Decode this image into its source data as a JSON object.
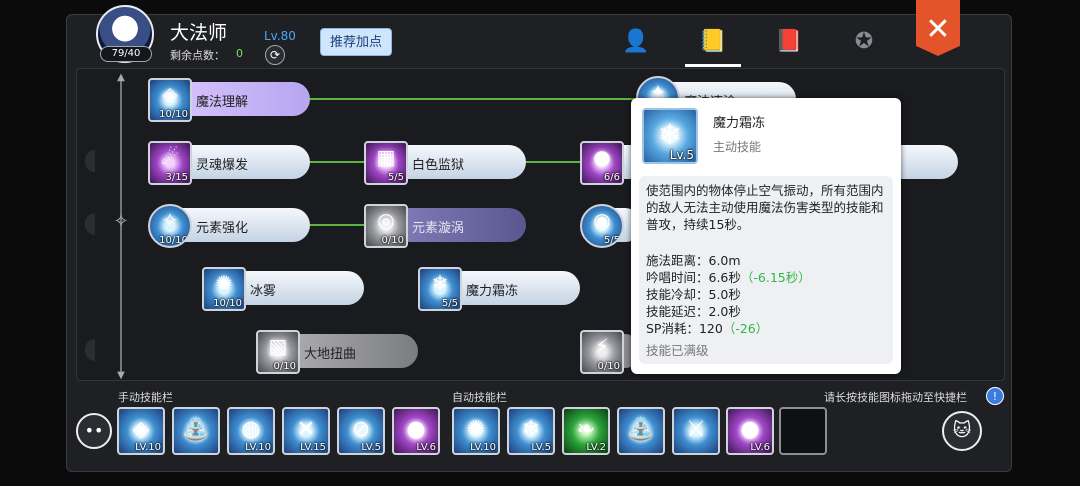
{
  "header": {
    "avatar_count": "79/40",
    "name": "大法师",
    "points_label": "剩余点数：",
    "points_value": "0",
    "level": "Lv.80",
    "recommend_label": "推荐加点",
    "tabs": [
      "character-icon",
      "skill-book-icon",
      "book-icon",
      "emblem-icon"
    ],
    "active_tab": "skill-book-icon",
    "close_icon": "close-x-icon"
  },
  "skills": [
    {
      "name": "魔法理解",
      "level": "10/10",
      "icon": "diamond-rune-icon",
      "color": "blue"
    },
    {
      "name": "魔法速涂",
      "level": "",
      "icon": "star-rune-icon",
      "color": "blue"
    },
    {
      "name": "灵魂爆发",
      "level": "3/15",
      "icon": "soul-burst-icon",
      "color": "purple"
    },
    {
      "name": "白色监狱",
      "level": "5/5",
      "icon": "prism-cage-icon",
      "color": "purple"
    },
    {
      "name": "",
      "level": "6/6",
      "icon": "purple-orb-icon",
      "color": "purple"
    },
    {
      "name": "元素强化",
      "level": "10/10",
      "icon": "element-star-icon",
      "color": "blue"
    },
    {
      "name": "元素漩涡",
      "level": "0/10",
      "icon": "vortex-icon",
      "color": "gray"
    },
    {
      "name": "",
      "level": "5/5",
      "icon": "eye-rune-icon",
      "color": "blue"
    },
    {
      "name": "冰雾",
      "level": "10/10",
      "icon": "ice-mist-icon",
      "color": "blue"
    },
    {
      "name": "魔力霜冻",
      "level": "5/5",
      "icon": "snowflake-icon",
      "color": "blue"
    },
    {
      "name": "大地扭曲",
      "level": "0/10",
      "icon": "earth-crack-icon",
      "color": "gray"
    },
    {
      "name": "",
      "level": "0/10",
      "icon": "lightning-icon",
      "color": "gray"
    }
  ],
  "tooltip": {
    "title": "魔力霜冻",
    "type": "主动技能",
    "level": "Lv.5",
    "icon": "snowflake-icon",
    "description": "使范围内的物体停止空气振动，所有范围内的敌人无法主动使用魔法伤害类型的技能和普攻，持续15秒。",
    "stats": [
      {
        "label": "施法距离：6.0m",
        "mod": ""
      },
      {
        "label": "吟唱时间：6.6秒",
        "mod": "（-6.15秒）"
      },
      {
        "label": "技能冷却：5.0秒",
        "mod": ""
      },
      {
        "label": "技能延迟：2.0秒",
        "mod": ""
      },
      {
        "label": "SP消耗：120",
        "mod": "（-26）"
      }
    ],
    "footer": "技能已满级",
    "mod_color": "#33b54a"
  },
  "bars": {
    "manual_label": "手动技能栏",
    "auto_label": "自动技能栏",
    "hint": "请长按技能图标拖动至快捷栏",
    "manual": [
      {
        "level": "LV.10",
        "icon": "diamond-rune-icon",
        "color": "blue"
      },
      {
        "level": "",
        "icon": "pillar-burst-icon",
        "color": "blue"
      },
      {
        "level": "LV.10",
        "icon": "frost-ring-icon",
        "color": "blue"
      },
      {
        "level": "LV.15",
        "icon": "cross-blades-icon",
        "color": "blue"
      },
      {
        "level": "LV.5",
        "icon": "ban-icon",
        "color": "blue"
      },
      {
        "level": "LV.6",
        "icon": "purple-orb-icon",
        "color": "purple"
      }
    ],
    "auto": [
      {
        "level": "LV.10",
        "icon": "ice-mist-icon",
        "color": "blue"
      },
      {
        "level": "LV.5",
        "icon": "snowflake-icon",
        "color": "blue"
      },
      {
        "level": "LV.2",
        "icon": "leaf-wind-icon",
        "color": "green"
      },
      {
        "level": "",
        "icon": "pillar-burst-icon",
        "color": "blue"
      },
      {
        "level": "",
        "icon": "sword-burst-icon",
        "color": "blue"
      },
      {
        "level": "LV.6",
        "icon": "purple-orb-icon",
        "color": "purple"
      }
    ]
  }
}
